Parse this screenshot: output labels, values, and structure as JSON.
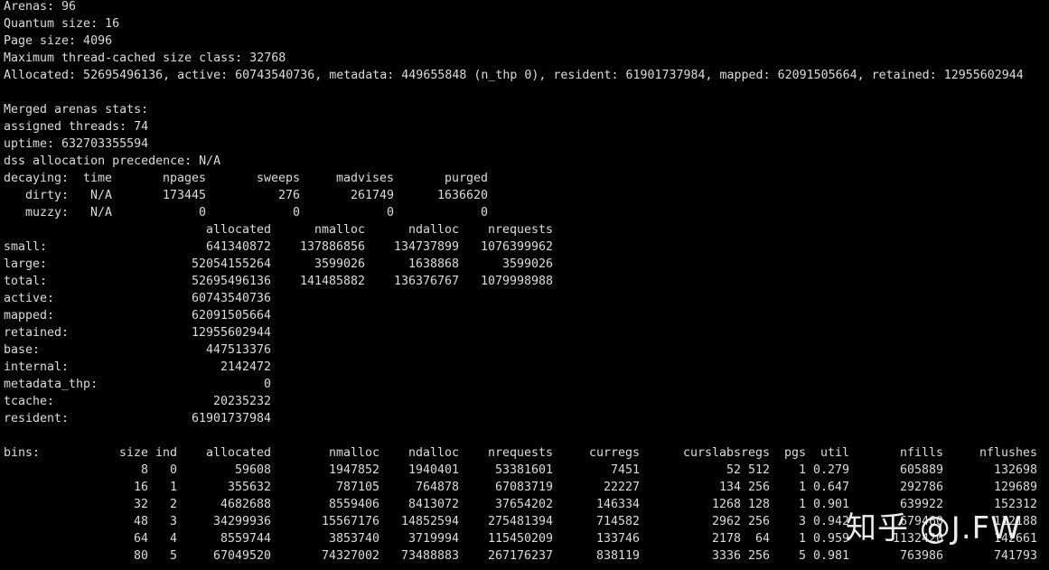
{
  "header": {
    "arenas": "Arenas: 96",
    "quantum": "Quantum size: 16",
    "page_size": "Page size: 4096",
    "max_tcache": "Maximum thread-cached size class: 32768",
    "summary": "Allocated: 52695496136, active: 60743540736, metadata: 449655848 (n_thp 0), resident: 61901737984, mapped: 62091505664, retained: 12955602944"
  },
  "merged": {
    "title": "Merged arenas stats:",
    "assigned_threads": "assigned threads: 74",
    "uptime": "uptime: 632703355594",
    "dss": "dss allocation precedence: N/A"
  },
  "decaying": {
    "headers": [
      "decaying:",
      "time",
      "npages",
      "sweeps",
      "madvises",
      "purged"
    ],
    "rows": [
      [
        "dirty:",
        "N/A",
        "173445",
        "276",
        "261749",
        "1636620"
      ],
      [
        "muzzy:",
        "N/A",
        "0",
        "0",
        "0",
        "0"
      ]
    ]
  },
  "totals": {
    "headers": [
      "",
      "allocated",
      "nmalloc",
      "ndalloc",
      "nrequests"
    ],
    "rows": [
      [
        "small:",
        "641340872",
        "137886856",
        "134737899",
        "1076399962"
      ],
      [
        "large:",
        "52054155264",
        "3599026",
        "1638868",
        "3599026"
      ],
      [
        "total:",
        "52695496136",
        "141485882",
        "136376767",
        "1079998988"
      ],
      [
        "active:",
        "60743540736"
      ],
      [
        "mapped:",
        "62091505664"
      ],
      [
        "retained:",
        "12955602944"
      ],
      [
        "base:",
        "447513376"
      ],
      [
        "internal:",
        "2142472"
      ],
      [
        "metadata_thp:",
        "0"
      ],
      [
        "tcache:",
        "20235232"
      ],
      [
        "resident:",
        "61901737984"
      ]
    ]
  },
  "bins": {
    "headers": [
      "bins:",
      "size",
      "ind",
      "allocated",
      "nmalloc",
      "ndalloc",
      "nrequests",
      "curregs",
      "curslabs",
      "regs",
      "pgs",
      "util",
      "nfills",
      "nflushes"
    ],
    "rows": [
      [
        "",
        "8",
        "0",
        "59608",
        "1947852",
        "1940401",
        "53381601",
        "7451",
        "52",
        "512",
        "1",
        "0.279",
        "605889",
        "132698"
      ],
      [
        "",
        "16",
        "1",
        "355632",
        "787105",
        "764878",
        "67083719",
        "22227",
        "134",
        "256",
        "1",
        "0.647",
        "292786",
        "129689"
      ],
      [
        "",
        "32",
        "2",
        "4682688",
        "8559406",
        "8413072",
        "37654202",
        "146334",
        "1268",
        "128",
        "1",
        "0.901",
        "639922",
        "152312"
      ],
      [
        "",
        "48",
        "3",
        "34299936",
        "15567176",
        "14852594",
        "275481394",
        "714582",
        "2962",
        "256",
        "3",
        "0.942",
        "679460",
        "112188"
      ],
      [
        "",
        "64",
        "4",
        "8559744",
        "3853740",
        "3719994",
        "115450209",
        "133746",
        "2178",
        "64",
        "1",
        "0.959",
        "1132420",
        "142661"
      ],
      [
        "",
        "80",
        "5",
        "67049520",
        "74327002",
        "73488883",
        "267176237",
        "838119",
        "3336",
        "256",
        "5",
        "0.981",
        "763986",
        "741793"
      ]
    ]
  },
  "watermark": "知乎 @J.FW",
  "colors": {
    "background": "#000000",
    "text": "#dcdcdc"
  }
}
